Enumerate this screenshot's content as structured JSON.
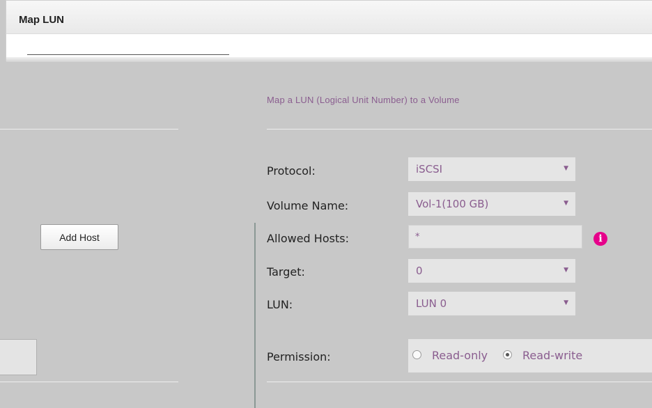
{
  "window": {
    "title": "Map LUN"
  },
  "form": {
    "subtitle": "Map a LUN (Logical Unit Number) to a Volume",
    "protocol": {
      "label": "Protocol:",
      "value": "iSCSI"
    },
    "volume_name": {
      "label": "Volume Name:",
      "value": "Vol-1(100 GB)"
    },
    "allowed_hosts": {
      "label": "Allowed Hosts:",
      "value": "*"
    },
    "target": {
      "label": "Target:",
      "value": "0"
    },
    "lun": {
      "label": "LUN:",
      "value": "LUN 0"
    },
    "permission": {
      "label": "Permission:",
      "options": [
        {
          "label": "Read-only",
          "checked": false
        },
        {
          "label": "Read-write",
          "checked": true
        }
      ]
    }
  },
  "left_panel": {
    "add_host_label": "Add Host"
  },
  "icons": {
    "info": "info-icon",
    "dropdown": "dropdown-arrow-icon"
  },
  "colors": {
    "accent": "#e6008a",
    "value_text": "#8a5d8f",
    "background": "#c8c8c8"
  }
}
